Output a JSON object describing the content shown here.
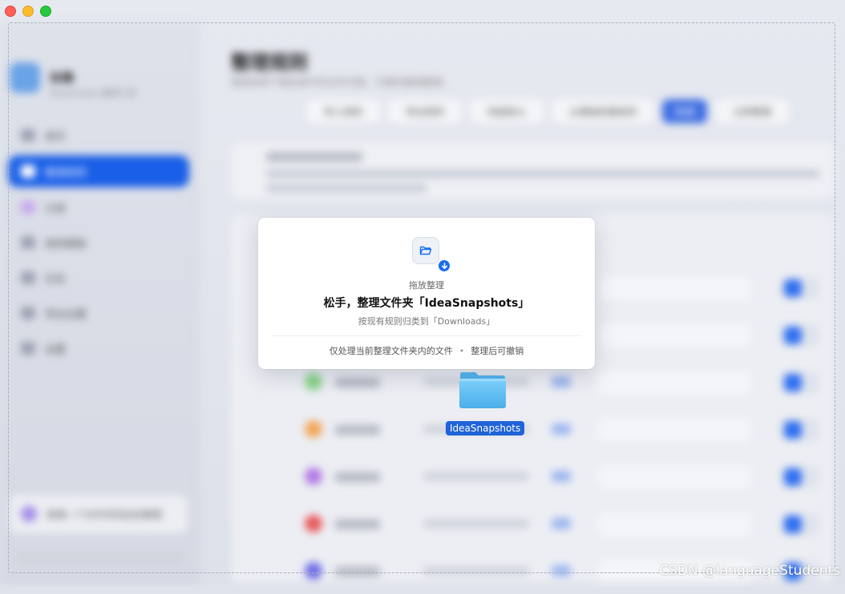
{
  "background_app": {
    "app_name": "拾趣",
    "app_subtitle": "Downloads 整理工具",
    "nav_items": [
      "首页",
      "整理规则",
      "分类",
      "规则模板",
      "历史",
      "导出设置",
      "设置"
    ],
    "active_nav_index": 1,
    "sidebar_card_label": "拖拽一个文件夹到此处整理",
    "main_title": "整理规则",
    "main_subtitle": "按规则将下载目录中的文件归类，可随时撤销整理",
    "toolbar_buttons": [
      "导入规则",
      "导出规则",
      "恢复默认",
      "从模板新建规则",
      "新建",
      "立即整理"
    ],
    "row_icon_colors": [
      "#b9c0cc",
      "#b9c0cc",
      "#8ad48a",
      "#f2a65a",
      "#b27be6",
      "#ea5a5a",
      "#6f6ee6"
    ]
  },
  "dialog": {
    "eyebrow": "拖放整理",
    "title": "松手，整理文件夹「IdeaSnapshots」",
    "description": "按现有规则归类到「Downloads」",
    "footer_left": "仅处理当前整理文件夹内的文件",
    "footer_sep": "•",
    "footer_right": "整理后可撤销",
    "icon": "folder-open-icon",
    "badge_icon": "arrow-down-icon",
    "accent_color": "#1a6df0"
  },
  "drag": {
    "folder_label": "IdeaSnapshots",
    "icon": "folder-icon"
  },
  "watermark": "CSDN @languageStudents"
}
